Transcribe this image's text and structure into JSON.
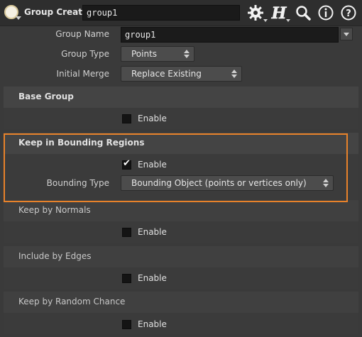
{
  "header": {
    "node_type": "Group Create",
    "node_name": "group1",
    "icons": [
      "node-type-icon",
      "gear-icon",
      "help-h-icon",
      "search-icon",
      "info-icon",
      "question-icon"
    ]
  },
  "params": {
    "group_name": {
      "label": "Group Name",
      "value": "group1"
    },
    "group_type": {
      "label": "Group Type",
      "value": "Points"
    },
    "initial_merge": {
      "label": "Initial Merge",
      "value": "Replace Existing"
    }
  },
  "folders": {
    "base_group": {
      "title": "Base Group",
      "enable_label": "Enable",
      "enabled": false
    },
    "bounding": {
      "title": "Keep in Bounding Regions",
      "enable_label": "Enable",
      "enabled": true,
      "bounding_type_label": "Bounding Type",
      "bounding_type_value": "Bounding Object (points or vertices only)"
    },
    "normals": {
      "title": "Keep by Normals",
      "enable_label": "Enable",
      "enabled": false
    },
    "edges": {
      "title": "Include by Edges",
      "enable_label": "Enable",
      "enabled": false
    },
    "random": {
      "title": "Keep by Random Chance",
      "enable_label": "Enable",
      "enabled": false
    }
  },
  "colors": {
    "highlight": "#e8822a",
    "background": "#3a3a3a"
  }
}
